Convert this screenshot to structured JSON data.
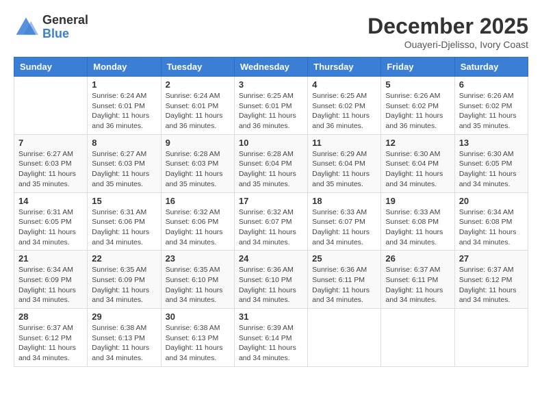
{
  "header": {
    "logo_general": "General",
    "logo_blue": "Blue",
    "month_title": "December 2025",
    "subtitle": "Ouayeri-Djelisso, Ivory Coast"
  },
  "weekdays": [
    "Sunday",
    "Monday",
    "Tuesday",
    "Wednesday",
    "Thursday",
    "Friday",
    "Saturday"
  ],
  "weeks": [
    [
      {
        "day": "",
        "info": ""
      },
      {
        "day": "1",
        "info": "Sunrise: 6:24 AM\nSunset: 6:01 PM\nDaylight: 11 hours and 36 minutes."
      },
      {
        "day": "2",
        "info": "Sunrise: 6:24 AM\nSunset: 6:01 PM\nDaylight: 11 hours and 36 minutes."
      },
      {
        "day": "3",
        "info": "Sunrise: 6:25 AM\nSunset: 6:01 PM\nDaylight: 11 hours and 36 minutes."
      },
      {
        "day": "4",
        "info": "Sunrise: 6:25 AM\nSunset: 6:02 PM\nDaylight: 11 hours and 36 minutes."
      },
      {
        "day": "5",
        "info": "Sunrise: 6:26 AM\nSunset: 6:02 PM\nDaylight: 11 hours and 36 minutes."
      },
      {
        "day": "6",
        "info": "Sunrise: 6:26 AM\nSunset: 6:02 PM\nDaylight: 11 hours and 35 minutes."
      }
    ],
    [
      {
        "day": "7",
        "info": "Sunrise: 6:27 AM\nSunset: 6:03 PM\nDaylight: 11 hours and 35 minutes."
      },
      {
        "day": "8",
        "info": "Sunrise: 6:27 AM\nSunset: 6:03 PM\nDaylight: 11 hours and 35 minutes."
      },
      {
        "day": "9",
        "info": "Sunrise: 6:28 AM\nSunset: 6:03 PM\nDaylight: 11 hours and 35 minutes."
      },
      {
        "day": "10",
        "info": "Sunrise: 6:28 AM\nSunset: 6:04 PM\nDaylight: 11 hours and 35 minutes."
      },
      {
        "day": "11",
        "info": "Sunrise: 6:29 AM\nSunset: 6:04 PM\nDaylight: 11 hours and 35 minutes."
      },
      {
        "day": "12",
        "info": "Sunrise: 6:30 AM\nSunset: 6:04 PM\nDaylight: 11 hours and 34 minutes."
      },
      {
        "day": "13",
        "info": "Sunrise: 6:30 AM\nSunset: 6:05 PM\nDaylight: 11 hours and 34 minutes."
      }
    ],
    [
      {
        "day": "14",
        "info": "Sunrise: 6:31 AM\nSunset: 6:05 PM\nDaylight: 11 hours and 34 minutes."
      },
      {
        "day": "15",
        "info": "Sunrise: 6:31 AM\nSunset: 6:06 PM\nDaylight: 11 hours and 34 minutes."
      },
      {
        "day": "16",
        "info": "Sunrise: 6:32 AM\nSunset: 6:06 PM\nDaylight: 11 hours and 34 minutes."
      },
      {
        "day": "17",
        "info": "Sunrise: 6:32 AM\nSunset: 6:07 PM\nDaylight: 11 hours and 34 minutes."
      },
      {
        "day": "18",
        "info": "Sunrise: 6:33 AM\nSunset: 6:07 PM\nDaylight: 11 hours and 34 minutes."
      },
      {
        "day": "19",
        "info": "Sunrise: 6:33 AM\nSunset: 6:08 PM\nDaylight: 11 hours and 34 minutes."
      },
      {
        "day": "20",
        "info": "Sunrise: 6:34 AM\nSunset: 6:08 PM\nDaylight: 11 hours and 34 minutes."
      }
    ],
    [
      {
        "day": "21",
        "info": "Sunrise: 6:34 AM\nSunset: 6:09 PM\nDaylight: 11 hours and 34 minutes."
      },
      {
        "day": "22",
        "info": "Sunrise: 6:35 AM\nSunset: 6:09 PM\nDaylight: 11 hours and 34 minutes."
      },
      {
        "day": "23",
        "info": "Sunrise: 6:35 AM\nSunset: 6:10 PM\nDaylight: 11 hours and 34 minutes."
      },
      {
        "day": "24",
        "info": "Sunrise: 6:36 AM\nSunset: 6:10 PM\nDaylight: 11 hours and 34 minutes."
      },
      {
        "day": "25",
        "info": "Sunrise: 6:36 AM\nSunset: 6:11 PM\nDaylight: 11 hours and 34 minutes."
      },
      {
        "day": "26",
        "info": "Sunrise: 6:37 AM\nSunset: 6:11 PM\nDaylight: 11 hours and 34 minutes."
      },
      {
        "day": "27",
        "info": "Sunrise: 6:37 AM\nSunset: 6:12 PM\nDaylight: 11 hours and 34 minutes."
      }
    ],
    [
      {
        "day": "28",
        "info": "Sunrise: 6:37 AM\nSunset: 6:12 PM\nDaylight: 11 hours and 34 minutes."
      },
      {
        "day": "29",
        "info": "Sunrise: 6:38 AM\nSunset: 6:13 PM\nDaylight: 11 hours and 34 minutes."
      },
      {
        "day": "30",
        "info": "Sunrise: 6:38 AM\nSunset: 6:13 PM\nDaylight: 11 hours and 34 minutes."
      },
      {
        "day": "31",
        "info": "Sunrise: 6:39 AM\nSunset: 6:14 PM\nDaylight: 11 hours and 34 minutes."
      },
      {
        "day": "",
        "info": ""
      },
      {
        "day": "",
        "info": ""
      },
      {
        "day": "",
        "info": ""
      }
    ]
  ]
}
